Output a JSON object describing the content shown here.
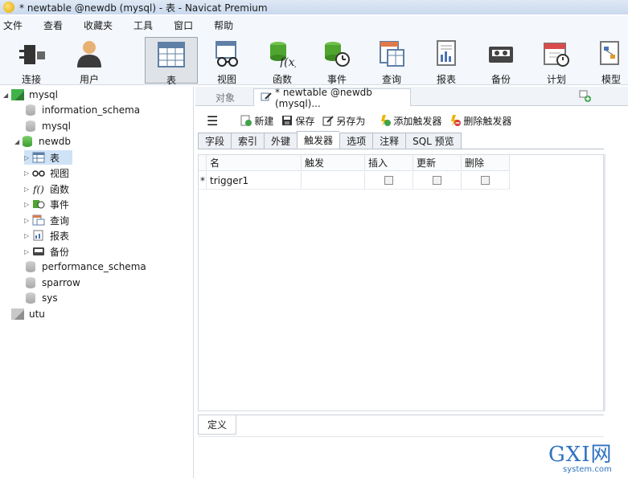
{
  "window": {
    "title": "* newtable @newdb (mysql) - 表 - Navicat Premium"
  },
  "menu": [
    "文件",
    "查看",
    "收藏夹",
    "工具",
    "窗口",
    "帮助"
  ],
  "toolbar": [
    {
      "label": "连接",
      "icon": "plug-icon"
    },
    {
      "label": "用户",
      "icon": "user-icon"
    },
    {
      "label": "表",
      "icon": "table-icon"
    },
    {
      "label": "视图",
      "icon": "view-glasses-icon"
    },
    {
      "label": "函数",
      "icon": "function-icon"
    },
    {
      "label": "事件",
      "icon": "event-clock-icon"
    },
    {
      "label": "查询",
      "icon": "query-icon"
    },
    {
      "label": "报表",
      "icon": "report-icon"
    },
    {
      "label": "备份",
      "icon": "backup-tape-icon"
    },
    {
      "label": "计划",
      "icon": "schedule-calendar-icon"
    },
    {
      "label": "模型",
      "icon": "model-icon"
    }
  ],
  "tree": {
    "connections": [
      {
        "name": "mysql"
      },
      {
        "name": "utu"
      }
    ],
    "mysql_dbs": [
      "information_schema",
      "mysql",
      "newdb",
      "performance_schema",
      "sparrow",
      "sys"
    ],
    "newdb_children": [
      "表",
      "视图",
      "函数",
      "事件",
      "查询",
      "报表",
      "备份"
    ]
  },
  "object_tabs": {
    "objects_label": "对象",
    "editor_label": "* newtable @newdb (mysql)..."
  },
  "actions": {
    "new": "新建",
    "save": "保存",
    "save_as": "另存为",
    "add_trigger": "添加触发器",
    "delete_trigger": "删除触发器"
  },
  "field_tabs": [
    "字段",
    "索引",
    "外键",
    "触发器",
    "选项",
    "注释",
    "SQL 预览"
  ],
  "grid": {
    "headers": [
      "名",
      "触发",
      "插入",
      "更新",
      "删除"
    ],
    "rows": [
      {
        "marker": "*",
        "name": "trigger1",
        "trigger": "",
        "insert": false,
        "update": false,
        "delete": false
      }
    ]
  },
  "definition_tab": "定义",
  "watermark": {
    "main": "GXI网",
    "sub": "system.com"
  },
  "colors": {
    "accent": "#2f73c0",
    "active_tab_bg": "#ffffff",
    "conn_green": "#41b24a"
  }
}
